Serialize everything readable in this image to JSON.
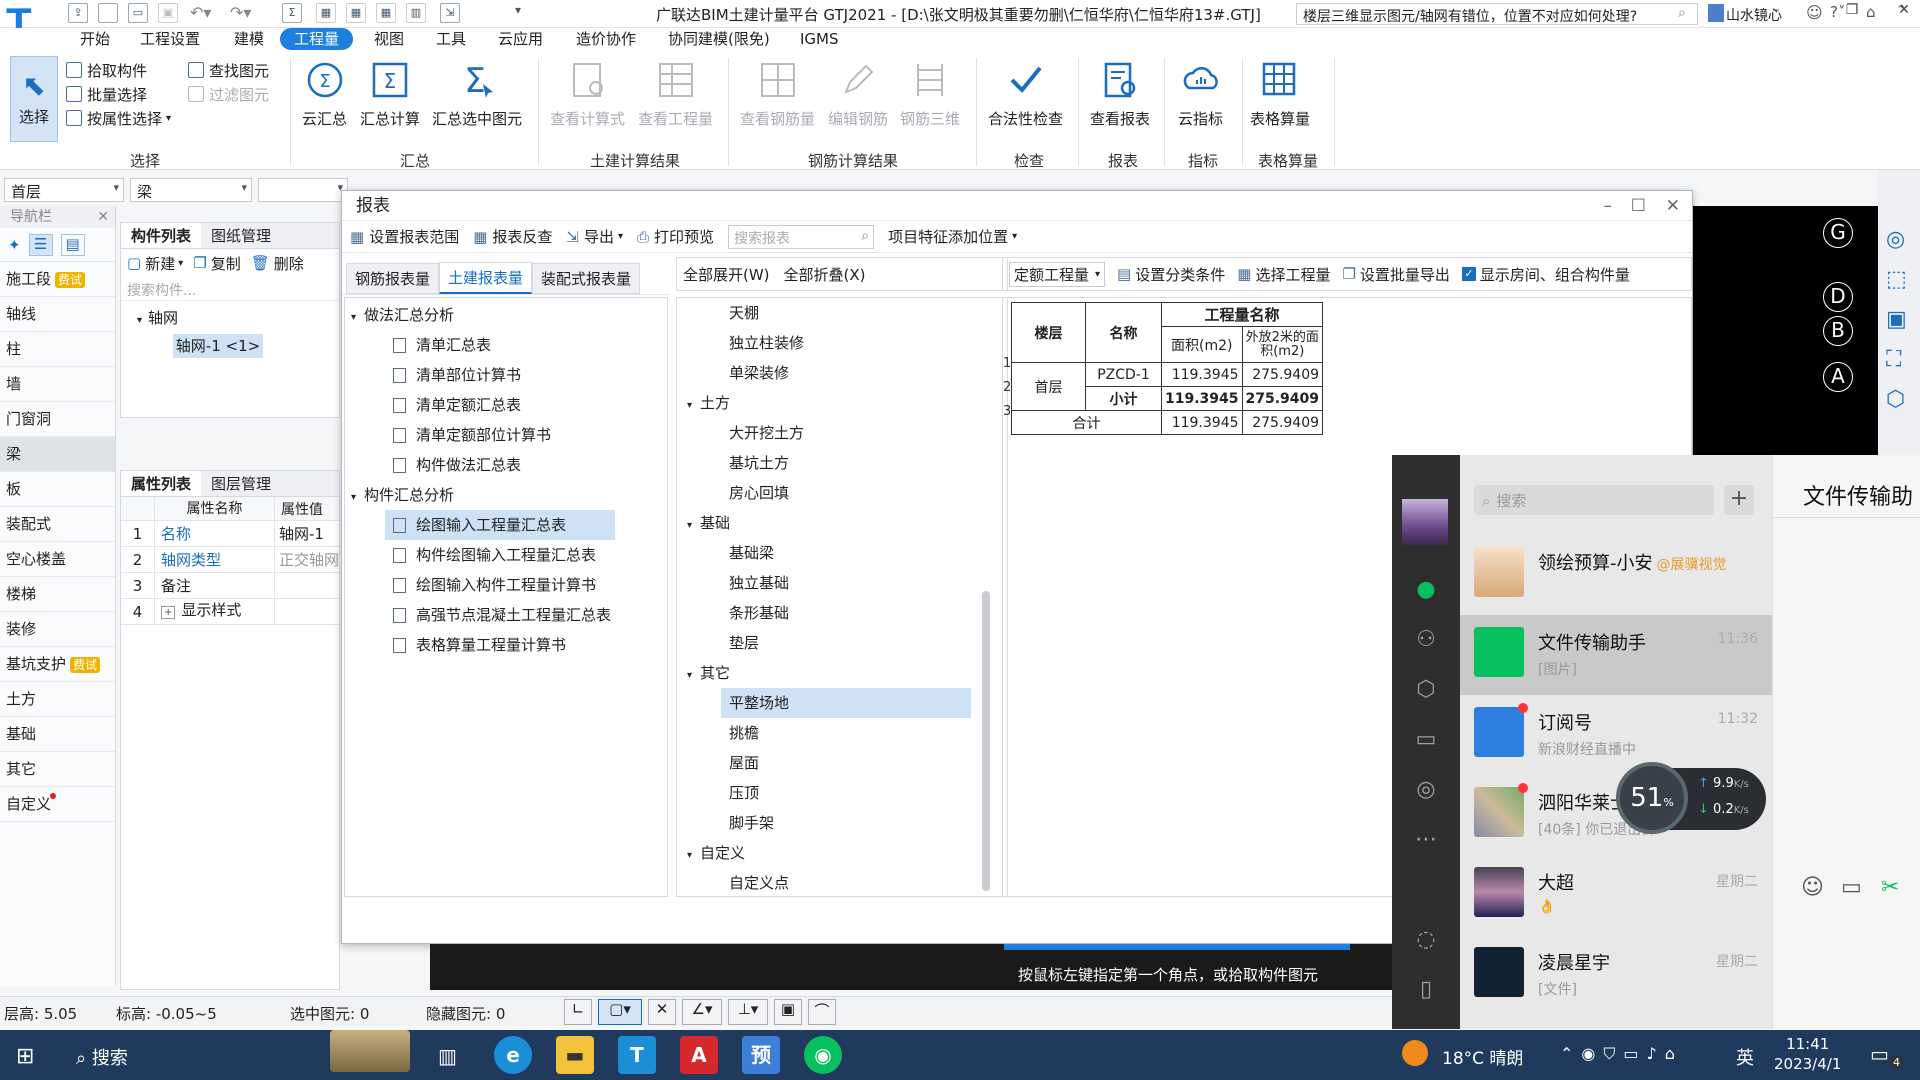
{
  "app": {
    "title": "广联达BIM土建计量平台 GTJ2021 - [D:\\张文明极其重要勿删\\仁恒华府\\仁恒华府13#.GTJ]",
    "help_search": "楼层三维显示图元/轴网有错位，位置不对应如何处理?",
    "user": "山水镜心"
  },
  "menu": [
    "开始",
    "工程设置",
    "建模",
    "工程量",
    "视图",
    "工具",
    "云应用",
    "造价协作",
    "协同建模(限免)",
    "IGMS"
  ],
  "ribbon": {
    "select_group": {
      "label": "选择",
      "big": "选择",
      "small": [
        "拾取构件",
        "批量选择",
        "按属性选择",
        "查找图元",
        "过滤图元"
      ]
    },
    "summary_group": {
      "label": "汇总",
      "buttons": [
        "云汇总",
        "汇总计算",
        "汇总选中图元"
      ]
    },
    "civil_group": {
      "label": "土建计算结果",
      "buttons": [
        "查看计算式",
        "查看工程量"
      ]
    },
    "rebar_group": {
      "label": "钢筋计算结果",
      "buttons": [
        "查看钢筋量",
        "编辑钢筋",
        "钢筋三维"
      ]
    },
    "check_group": {
      "label": "检查",
      "buttons": [
        "合法性检查"
      ]
    },
    "report_group": {
      "label": "报表",
      "buttons": [
        "查看报表"
      ]
    },
    "index_group": {
      "label": "指标",
      "buttons": [
        "云指标"
      ]
    },
    "table_group": {
      "label": "表格算量",
      "buttons": [
        "表格算量"
      ]
    }
  },
  "floor_select": "首层",
  "type_select": "梁",
  "nav": {
    "title": "导航栏",
    "items": [
      {
        "label": "施工段",
        "fee": "费试"
      },
      {
        "label": "轴线"
      },
      {
        "label": "柱"
      },
      {
        "label": "墙"
      },
      {
        "label": "门窗洞"
      },
      {
        "label": "梁",
        "selected": true
      },
      {
        "label": "板"
      },
      {
        "label": "装配式"
      },
      {
        "label": "空心楼盖"
      },
      {
        "label": "楼梯"
      },
      {
        "label": "装修"
      },
      {
        "label": "基坑支护",
        "fee": "费试"
      },
      {
        "label": "土方"
      },
      {
        "label": "基础"
      },
      {
        "label": "其它"
      },
      {
        "label": "自定义"
      }
    ]
  },
  "component_list": {
    "tabs": [
      "构件列表",
      "图纸管理"
    ],
    "new": "新建",
    "copy": "复制",
    "delete": "删除",
    "search_placeholder": "搜索构件...",
    "group": "轴网",
    "item": "轴网-1 <1>"
  },
  "property_list": {
    "tabs": [
      "属性列表",
      "图层管理"
    ],
    "col_name": "属性名称",
    "col_value": "属性值",
    "rows": [
      {
        "no": "1",
        "name": "名称",
        "value": "轴网-1"
      },
      {
        "no": "2",
        "name": "轴网类型",
        "value": "正交轴网"
      },
      {
        "no": "3",
        "name": "备注",
        "value": ""
      },
      {
        "no": "4",
        "name": "显示样式",
        "value": ""
      }
    ]
  },
  "report": {
    "title": "报表",
    "toolbar": [
      "设置报表范围",
      "报表反查",
      "导出",
      "打印预览"
    ],
    "search_placeholder": "搜索报表",
    "add_position": "项目特征添加位置",
    "tabs": [
      "钢筋报表量",
      "土建报表量",
      "装配式报表量"
    ],
    "expand_all": "全部展开(W)",
    "collapse_all": "全部折叠(X)",
    "left_tree": [
      {
        "group": "做法汇总分析",
        "items": [
          "清单汇总表",
          "清单部位计算书",
          "清单定额汇总表",
          "清单定额部位计算书",
          "构件做法汇总表"
        ]
      },
      {
        "group": "构件汇总分析",
        "items": [
          "绘图输入工程量汇总表",
          "构件绘图输入工程量汇总表",
          "绘图输入构件工程量计算书",
          "高强节点混凝土工程量汇总表",
          "表格算量工程量计算书"
        ]
      }
    ],
    "mid_tree": [
      {
        "leaf": "天棚"
      },
      {
        "leaf": "独立柱装修"
      },
      {
        "leaf": "单梁装修"
      },
      {
        "group": "土方"
      },
      {
        "leaf": "大开挖土方"
      },
      {
        "leaf": "基坑土方"
      },
      {
        "leaf": "房心回填"
      },
      {
        "group": "基础"
      },
      {
        "leaf": "基础梁"
      },
      {
        "leaf": "独立基础"
      },
      {
        "leaf": "条形基础"
      },
      {
        "leaf": "垫层"
      },
      {
        "group": "其它"
      },
      {
        "leaf": "平整场地",
        "selected": true
      },
      {
        "leaf": "挑檐"
      },
      {
        "leaf": "屋面"
      },
      {
        "leaf": "压顶"
      },
      {
        "leaf": "脚手架"
      },
      {
        "group": "自定义"
      },
      {
        "leaf": "自定义点"
      }
    ],
    "right_toolbar": {
      "quota": "定额工程量",
      "classify": "设置分类条件",
      "select": "选择工程量",
      "batch_export": "设置批量导出",
      "show_room": "显示房间、组合构件量"
    },
    "table": {
      "h_floor": "楼层",
      "h_name": "名称",
      "h_group": "工程量名称",
      "h_area": "面积(m2)",
      "h_area2": "外放2米的面积(m2)",
      "rows": [
        {
          "no": "1",
          "floor": "首层",
          "name": "PZCD-1",
          "area": "119.3945",
          "area2": "275.9409"
        },
        {
          "no": "2",
          "name": "小计",
          "area": "119.3945",
          "area2": "275.9409"
        },
        {
          "no": "3",
          "name": "合计",
          "area": "119.3945",
          "area2": "275.9409"
        }
      ]
    }
  },
  "canvas": {
    "axes": [
      "G",
      "D",
      "B",
      "A"
    ],
    "hint": "按鼠标左键指定第一个角点，或拾取构件图元"
  },
  "status": {
    "floor_height": "层高: 5.05",
    "elevation": "标高: -0.05~5",
    "selected": "选中图元: 0",
    "hidden": "隐藏图元: 0"
  },
  "wechat": {
    "search_placeholder": "搜索",
    "chat_title": "文件传输助",
    "chats": [
      {
        "name": "领绘预算-小安",
        "tag": "@展骥视觉",
        "msg": "",
        "time": ""
      },
      {
        "name": "文件传输助手",
        "msg": "[图片]",
        "time": "11:36",
        "selected": true
      },
      {
        "name": "订阅号",
        "msg": "新浪财经直播中",
        "time": "11:32"
      },
      {
        "name": "泗阳华莱士",
        "msg": "[40条] 你已退出群",
        "time": ""
      },
      {
        "name": "大超",
        "msg": "👌",
        "time": "星期二"
      },
      {
        "name": "凌晨星宇",
        "msg": "[文件]",
        "time": "星期二"
      }
    ],
    "speed": {
      "percent": "51",
      "pct_sign": "%",
      "up": "9.9",
      "down": "0.2",
      "unit": "K/s"
    }
  },
  "taskbar": {
    "search": "搜索",
    "weather": "18°C 晴朗",
    "ime": "英",
    "time": "11:41",
    "date": "2023/4/1",
    "notif": "4"
  }
}
